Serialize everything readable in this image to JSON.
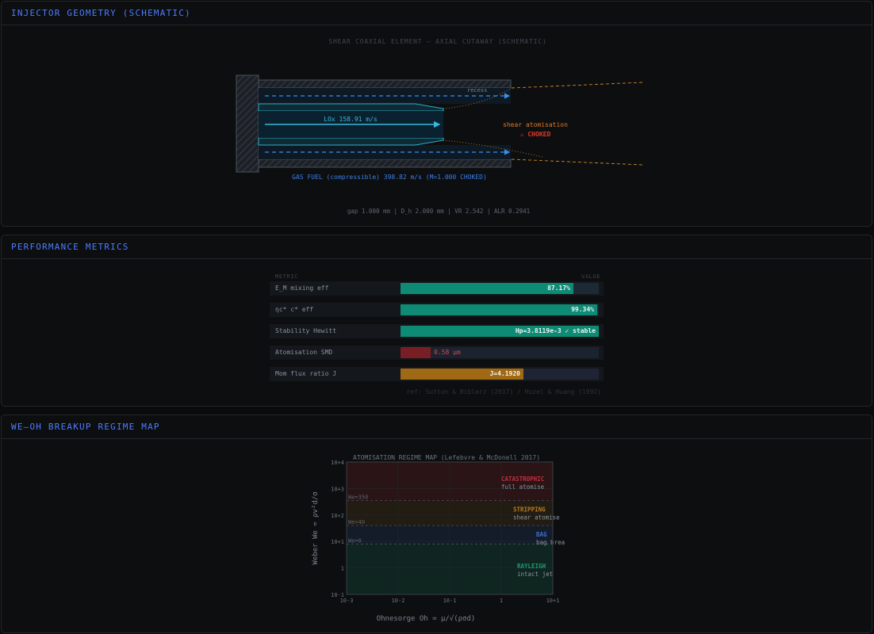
{
  "panels": {
    "geometry": {
      "title": "INJECTOR GEOMETRY (SCHEMATIC)",
      "diagram_title": "SHEAR COAXIAL ELEMENT — AXIAL CUTAWAY (SCHEMATIC)",
      "recess_label": "recess",
      "lox_label": "LOx 158.91 m/s",
      "shear_label": "shear atomisation",
      "choked_label": "⚠ CHOKED",
      "gas_label": "GAS FUEL (compressible) 398.82 m/s (M=1.000 CHOKED)",
      "footer": "gap 1.000 mm | D_h 2.000 mm | VR 2.542 | ALR 0.2941"
    },
    "metrics": {
      "title": "PERFORMANCE METRICS",
      "col_metric": "METRIC",
      "col_value": "VALUE",
      "rows": [
        {
          "label": "E_M  mixing eff",
          "value": "87.17%",
          "fraction": 0.8717,
          "color": "#0e8b75",
          "track": "#1c2a36"
        },
        {
          "label": "ηc*  c* eff",
          "value": "99.34%",
          "fraction": 0.9934,
          "color": "#0e8b75",
          "track": "#1c2a36"
        },
        {
          "label": "Stability  Hewitt",
          "value": "Hp=3.8119e-3  ✓ stable",
          "fraction": 1.0,
          "color": "#0e8b75",
          "track": "#1c2a36"
        },
        {
          "label": "Atomisation  SMD",
          "value": "0.58 µm",
          "fraction": 0.15,
          "color": "#7a1e26",
          "track": "#1b2330",
          "value_color": "#d24a4a",
          "value_outside": true
        },
        {
          "label": "Mom flux ratio J",
          "value": "J=4.1920",
          "fraction": 0.62,
          "color": "#a06a14",
          "track": "#1e2434"
        }
      ],
      "reference": "ref: Sutton & Biblarz (2017) / Huzel & Huang (1992)"
    },
    "regime": {
      "title": "WE–OH BREAKUP REGIME MAP"
    }
  },
  "chart_data": {
    "type": "heatmap",
    "title": "ATOMISATION REGIME MAP  (Lefebvre & McDonell 2017)",
    "xlabel": "Ohnesorge  Oh = μ/√(ρσd)",
    "ylabel": "Weber  We = ρv²d/σ",
    "x_scale": "log",
    "y_scale": "log",
    "x_ticks": [
      "10-3",
      "10-2",
      "10-1",
      "1",
      "10+1"
    ],
    "y_ticks": [
      "10+4",
      "10+3",
      "10+2",
      "10+1",
      "1",
      "10-1"
    ],
    "xlim": [
      0.001,
      10
    ],
    "ylim": [
      0.1,
      10000
    ],
    "grid": true,
    "thresholds": [
      {
        "label": "We=350",
        "We": 350
      },
      {
        "label": "We=40",
        "We": 40
      },
      {
        "label": "We=8",
        "We": 8
      }
    ],
    "regions": [
      {
        "name": "CATASTROPHIC",
        "desc": "full atomise",
        "from": 350,
        "to": 10000,
        "color": "#c0303a",
        "fill": "#2a1416"
      },
      {
        "name": "STRIPPING",
        "desc": "shear atomise",
        "from": 40,
        "to": 350,
        "color": "#b87a20",
        "fill": "#231c12"
      },
      {
        "name": "BAG",
        "desc": "bag brea",
        "from": 8,
        "to": 40,
        "color": "#3b6fd4",
        "fill": "#141c2a"
      },
      {
        "name": "RAYLEIGH",
        "desc": "intact jet",
        "from": 0.1,
        "to": 8,
        "color": "#1c9a70",
        "fill": "#0f2520"
      }
    ]
  }
}
